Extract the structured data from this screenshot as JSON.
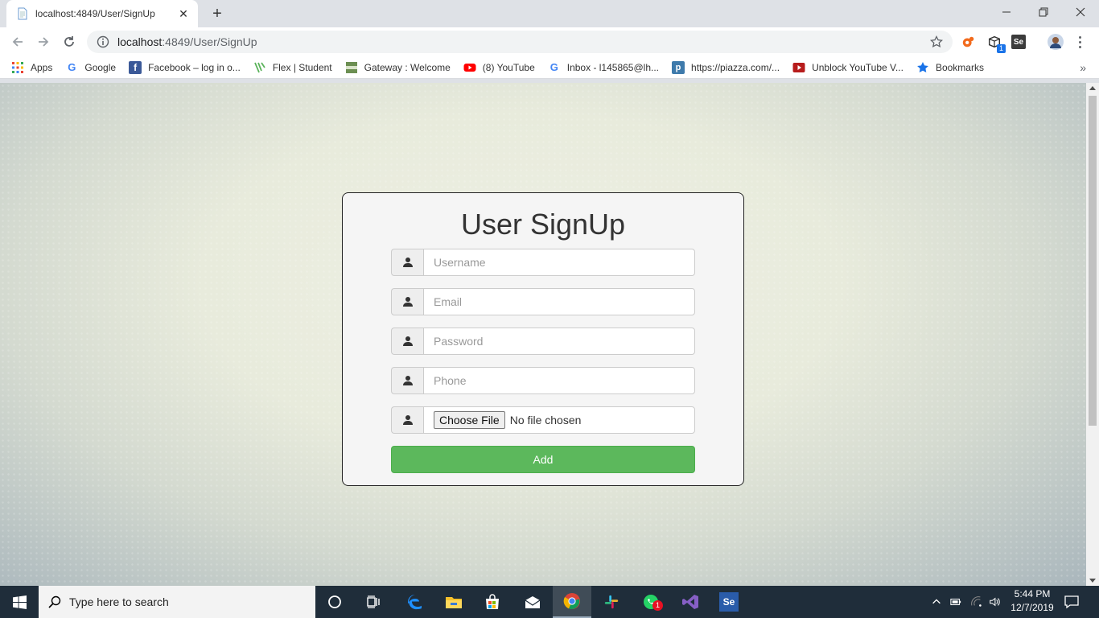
{
  "browser": {
    "tab": {
      "title": "localhost:4849/User/SignUp"
    },
    "address": {
      "host": "localhost",
      "path": ":4849/User/SignUp"
    },
    "bookmarks": [
      {
        "label": "Apps",
        "icon": "apps-grid-icon"
      },
      {
        "label": "Google",
        "icon": "google-icon"
      },
      {
        "label": "Facebook – log in o...",
        "icon": "facebook-icon"
      },
      {
        "label": "Flex | Student",
        "icon": "flex-icon"
      },
      {
        "label": "Gateway : Welcome",
        "icon": "gateway-icon"
      },
      {
        "label": "(8) YouTube",
        "icon": "youtube-icon"
      },
      {
        "label": "Inbox - l145865@lh...",
        "icon": "google-icon"
      },
      {
        "label": "https://piazza.com/...",
        "icon": "piazza-icon"
      },
      {
        "label": "Unblock YouTube V...",
        "icon": "youtube-icon"
      },
      {
        "label": "Bookmarks",
        "icon": "star-icon"
      }
    ],
    "more": "»",
    "extension_badge": "1",
    "selenium_ext": "Se"
  },
  "form": {
    "title": "User SignUp",
    "username_placeholder": "Username",
    "email_placeholder": "Email",
    "password_placeholder": "Password",
    "phone_placeholder": "Phone",
    "file_button": "Choose File",
    "file_status": "No file chosen",
    "submit": "Add"
  },
  "taskbar": {
    "search_placeholder": "Type here to search",
    "whatsapp_badge": "1",
    "vs_se": "Se",
    "time": "5:44 PM",
    "date": "12/7/2019"
  },
  "colors": {
    "add_button": "#5cb85c",
    "taskbar": "#1f2d3a"
  }
}
